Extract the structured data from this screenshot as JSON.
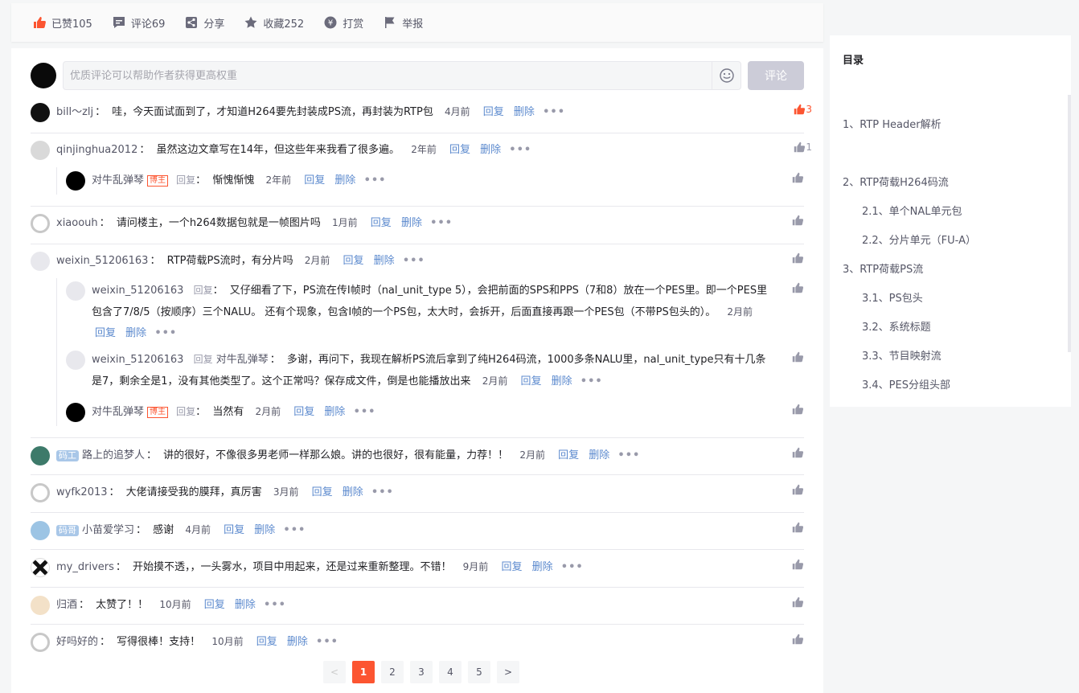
{
  "colors": {
    "accent": "#fc5531",
    "link": "#5c8ace",
    "muted": "#999aaa"
  },
  "toolbar": [
    {
      "icon": "thumbs-up-icon",
      "label": "已赞105"
    },
    {
      "icon": "comment-icon",
      "label": "评论69"
    },
    {
      "icon": "share-icon",
      "label": "分享"
    },
    {
      "icon": "star-icon",
      "label": "收藏252"
    },
    {
      "icon": "reward-icon",
      "label": "打赏"
    },
    {
      "icon": "flag-icon",
      "label": "举报"
    }
  ],
  "comment_input": {
    "placeholder": "优质评论可以帮助作者获得更高权重",
    "submit_label": "评论"
  },
  "labels": {
    "reply": "回复",
    "delete": "删除",
    "reply_tag": "回复",
    "blogger": "博主",
    "more": "•••"
  },
  "comments": [
    {
      "user": "bill～zlj",
      "text": "哇，今天面试面到了，才知道H264要先封装成PS流，再封装为RTP包",
      "time": "4月前",
      "likes": "3"
    },
    {
      "user": "qinjinghua2012",
      "text": "虽然这边文章写在14年，但这些年来我看了很多遍。",
      "time": "2年前",
      "likes": "1"
    },
    {
      "user": "对牛乱弹琴",
      "text": "惭愧惭愧",
      "time": "2年前"
    },
    {
      "user": "xiaoouh",
      "text": "请问楼主，一个h264数据包就是一帧图片吗",
      "time": "1月前"
    },
    {
      "user": "weixin_51206163",
      "text": "RTP荷载PS流时，有分片吗",
      "time": "2月前"
    },
    {
      "user": "weixin_51206163",
      "text": "又仔细看了下，PS流在传I帧时（nal_unit_type 5），会把前面的SPS和PPS（7和8）放在一个PES里。即一个PES里包含了7/8/5（按顺序）三个NALU。 还有个现象，包含I帧的一个PS包，太大时，会拆开，后面直接再跟一个PES包（不带PS包头的）。",
      "time": "2月前"
    },
    {
      "user": "weixin_51206163",
      "reply_to": "对牛乱弹琴",
      "text": "多谢，再问下，我现在解析PS流后拿到了纯H264码流，1000多条NALU里，nal_unit_type只有十几条是7，剩余全是1，没有其他类型了。这个正常吗？保存成文件，倒是也能播放出来",
      "time": "2月前"
    },
    {
      "user": "对牛乱弹琴",
      "text": "当然有",
      "time": "2月前"
    },
    {
      "user": "路上的追梦人",
      "badge": "码工",
      "text": "讲的很好，不像很多男老师一样那么娘。讲的也很好，很有能量，力荐！！",
      "time": "2月前"
    },
    {
      "user": "wyfk2013",
      "text": "大佬请接受我的膜拜，真厉害",
      "time": "3月前"
    },
    {
      "user": "小苗爱学习",
      "badge": "码哥",
      "text": "感谢",
      "time": "4月前"
    },
    {
      "user": "my_drivers",
      "text": "开始摸不透，，一头雾水，项目中用起来，还是过来重新整理。不错！",
      "time": "9月前"
    },
    {
      "user": "归酒",
      "text": "太赞了！！",
      "time": "10月前"
    },
    {
      "user": "好吗好的",
      "text": "写得很棒！支持！",
      "time": "10月前"
    }
  ],
  "pagination": {
    "prev": "<",
    "pages": [
      "1",
      "2",
      "3",
      "4",
      "5"
    ],
    "next": ">",
    "current": "1"
  },
  "toc": {
    "title": "目录",
    "items": [
      {
        "label": "1、RTP Header解析"
      },
      {
        "label": "2、RTP荷载H264码流"
      },
      {
        "label": "2.1、单个NAL单元包"
      },
      {
        "label": "2.2、分片单元（FU-A）"
      },
      {
        "label": "3、RTP荷载PS流"
      },
      {
        "label": "3.1、PS包头"
      },
      {
        "label": "3.2、系统标题"
      },
      {
        "label": "3.3、节目映射流"
      },
      {
        "label": "3.4、PES分组头部"
      }
    ]
  }
}
